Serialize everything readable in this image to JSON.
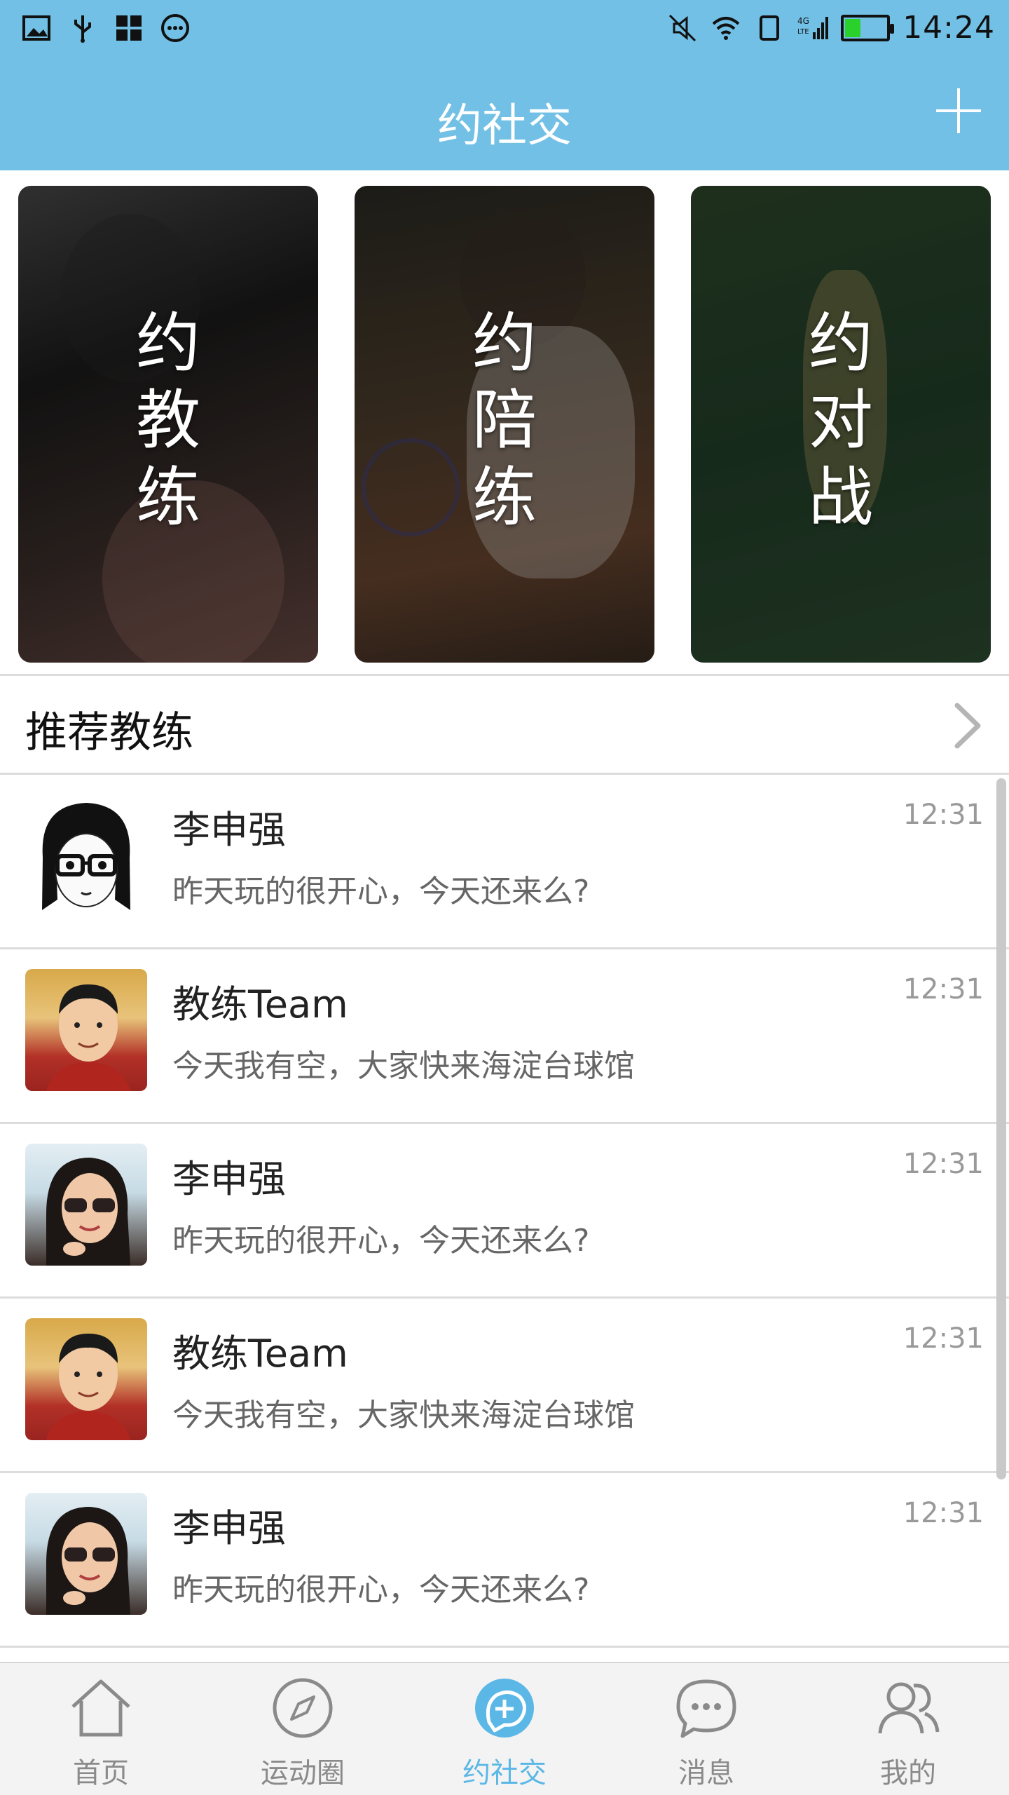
{
  "status_bar": {
    "time": "14:24",
    "battery_level": 0.35
  },
  "header": {
    "title": "约社交"
  },
  "cards": [
    {
      "chars": [
        "约",
        "教",
        "练"
      ]
    },
    {
      "chars": [
        "约",
        "陪",
        "练"
      ]
    },
    {
      "chars": [
        "约",
        "对",
        "战"
      ]
    }
  ],
  "section": {
    "title": "推荐教练"
  },
  "messages": [
    {
      "name": "李申强",
      "message": "昨天玩的很开心，今天还来么?",
      "time": "12:31"
    },
    {
      "name": "教练Team",
      "message": "今天我有空，大家快来海淀台球馆",
      "time": "12:31"
    },
    {
      "name": "李申强",
      "message": "昨天玩的很开心，今天还来么?",
      "time": "12:31"
    },
    {
      "name": "教练Team",
      "message": "今天我有空，大家快来海淀台球馆",
      "time": "12:31"
    },
    {
      "name": "李申强",
      "message": "昨天玩的很开心，今天还来么?",
      "time": "12:31"
    }
  ],
  "nav": [
    {
      "label": "首页",
      "icon": "home-icon"
    },
    {
      "label": "运动圈",
      "icon": "compass-icon"
    },
    {
      "label": "约社交",
      "icon": "social-icon",
      "active": true
    },
    {
      "label": "消息",
      "icon": "message-icon"
    },
    {
      "label": "我的",
      "icon": "user-icon"
    }
  ],
  "colors": {
    "header": "#72c0e5",
    "active": "#5bb7e6",
    "inactive": "#8a8a8a"
  }
}
